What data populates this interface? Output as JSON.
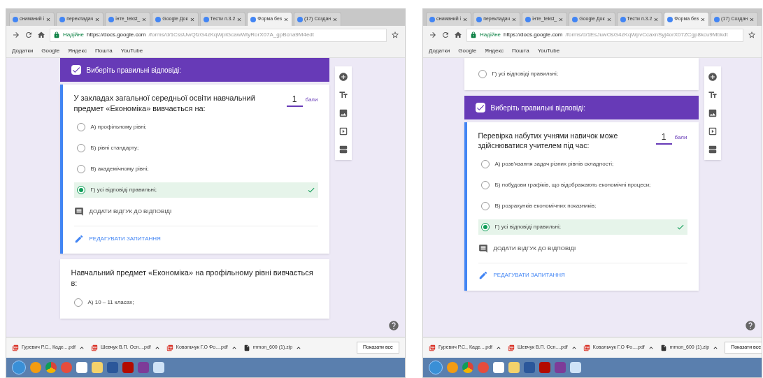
{
  "screens": [
    {
      "tabs": [
        {
          "label": "сниманий і",
          "selected": false
        },
        {
          "label": "перекладач",
          "selected": false
        },
        {
          "label": "інте_tekst_",
          "selected": false
        },
        {
          "label": "Google Док",
          "selected": false
        },
        {
          "label": "Тести п.3.2",
          "selected": false
        },
        {
          "label": "Форма без",
          "selected": true
        },
        {
          "label": "(17) Создан",
          "selected": false
        }
      ],
      "address": {
        "secure": "Надійне",
        "host": "https://docs.google.com",
        "path": "/forms/d/1CssUwQfzG4zKqWpiGcawWtyRorX07A_gpBcna9M4edt"
      },
      "bookmarks": [
        "Додатки",
        "Google",
        "Яндекс",
        "Пошта",
        "YouTube"
      ],
      "questions": [
        {
          "header": "Виберіть правильні відповіді:",
          "text": "У закладах загальної середньої освіти навчальний предмет «Економіка» вивчається на:",
          "points": "1",
          "points_label": "бали",
          "options": [
            {
              "label": "А) профільному рівні;",
              "selected": false,
              "correct": false
            },
            {
              "label": "Б) рівні стандарту;",
              "selected": false,
              "correct": false
            },
            {
              "label": "В) академічному рівні;",
              "selected": false,
              "correct": false
            },
            {
              "label": "Г) усі відповіді правильні;",
              "selected": true,
              "correct": true
            }
          ],
          "feedback": "ДОДАТИ ВІДГУК ДО ВІДПОВІДІ",
          "edit": "РЕДАГУВАТИ ЗАПИТАННЯ"
        },
        {
          "text": "Навчальний предмет «Економіка» на профільному рівні вивчається в:",
          "options": [
            {
              "label": "А) 10 – 11 класах;",
              "selected": false,
              "correct": false
            }
          ]
        }
      ],
      "downloads": [
        "Гуревич Р.С., Кадє....pdf",
        "Шевчук В.П. Осн....pdf",
        "Ковальчук Г.О Фо....pdf",
        "mmon_600 (1).zip"
      ],
      "show_all": "Показати все"
    },
    {
      "tabs": [
        {
          "label": "сниманий і",
          "selected": false
        },
        {
          "label": "перекладач",
          "selected": false
        },
        {
          "label": "інте_tekst_",
          "selected": false
        },
        {
          "label": "Google Док",
          "selected": false
        },
        {
          "label": "Тести п.3.2",
          "selected": false
        },
        {
          "label": "Форма без",
          "selected": true
        },
        {
          "label": "(17) Создан",
          "selected": false
        }
      ],
      "address": {
        "secure": "Надійне",
        "host": "https://docs.google.com",
        "path": "/forms/d/1EsJuwOsG4zKqWpvCcaxnSyj4orX07ZCgp8kcu9Mbkdt"
      },
      "bookmarks": [
        "Додатки",
        "Google",
        "Яндекс",
        "Пошта",
        "YouTube"
      ],
      "questions": [
        {
          "options": [
            {
              "label": "Г) усі відповіді правильні;",
              "selected": false,
              "correct": false
            }
          ]
        },
        {
          "header": "Виберіть правильні відповіді:",
          "text": "Перевірка набутих учнями навичок може здійснюватися учителем під час:",
          "points": "1",
          "points_label": "бали",
          "options": [
            {
              "label": "А) розв'язання задач різних рівнів складності;",
              "selected": false,
              "correct": false
            },
            {
              "label": "Б) побудови графіків, що відображають економічні процеси;",
              "selected": false,
              "correct": false
            },
            {
              "label": "В) розрахунків економічних показників;",
              "selected": false,
              "correct": false
            },
            {
              "label": "Г) усі відповіді правильні;",
              "selected": true,
              "correct": true
            }
          ],
          "feedback": "ДОДАТИ ВІДГУК ДО ВІДПОВІДІ",
          "edit": "РЕДАГУВАТИ ЗАПИТАННЯ"
        }
      ],
      "downloads": [
        "Гуревич Р.С., Кадє....pdf",
        "Шевчук В.П. Осн....pdf",
        "Ковальчук Г.О Фо....pdf",
        "mmon_600 (1).zip"
      ],
      "show_all": "Показати все"
    }
  ]
}
